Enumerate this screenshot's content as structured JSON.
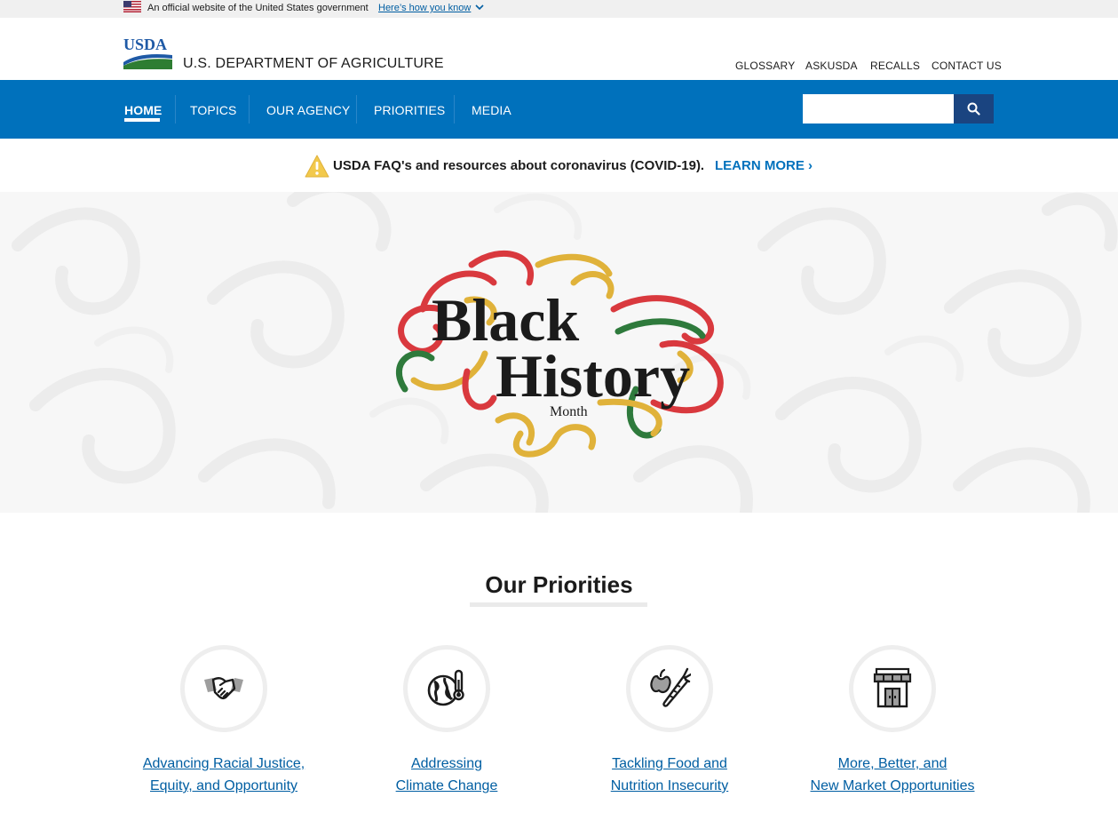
{
  "gov_banner": {
    "text": "An official website of the United States government",
    "link": "Here’s how you know"
  },
  "header": {
    "logo_text": "USDA",
    "agency_name": "U.S. DEPARTMENT OF AGRICULTURE",
    "util_links": [
      "GLOSSARY",
      "ASKUSDA",
      "RECALLS",
      "CONTACT US"
    ]
  },
  "nav": {
    "items": [
      "HOME",
      "TOPICS",
      "OUR AGENCY",
      "PRIORITIES",
      "MEDIA"
    ],
    "active": "HOME",
    "search_placeholder": ""
  },
  "alert": {
    "text": "USDA FAQ's and resources about coronavirus (COVID-19).",
    "link": "LEARN MORE ›"
  },
  "hero": {
    "title_line1": "Black",
    "title_line2": "History",
    "title_line3": "Month"
  },
  "priorities": {
    "title": "Our Priorities",
    "items": [
      {
        "line1": "Advancing Racial Justice,",
        "line2": "Equity, and Opportunity",
        "icon": "handshake-icon"
      },
      {
        "line1": "Addressing",
        "line2": "Climate Change",
        "icon": "globe-thermometer-icon"
      },
      {
        "line1": "Tackling Food and",
        "line2": "Nutrition Insecurity",
        "icon": "apple-carrot-icon"
      },
      {
        "line1": "More, Better, and",
        "line2": "New Market Opportunities",
        "icon": "storefront-icon"
      }
    ]
  },
  "colors": {
    "nav_blue": "#0071bc",
    "search_button": "#1a4480",
    "link_blue": "#005ea2",
    "usda_green": "#2e7d32",
    "bhm_red": "#d9393e",
    "bhm_gold": "#e0b23a",
    "bhm_green": "#2e7a3c"
  }
}
